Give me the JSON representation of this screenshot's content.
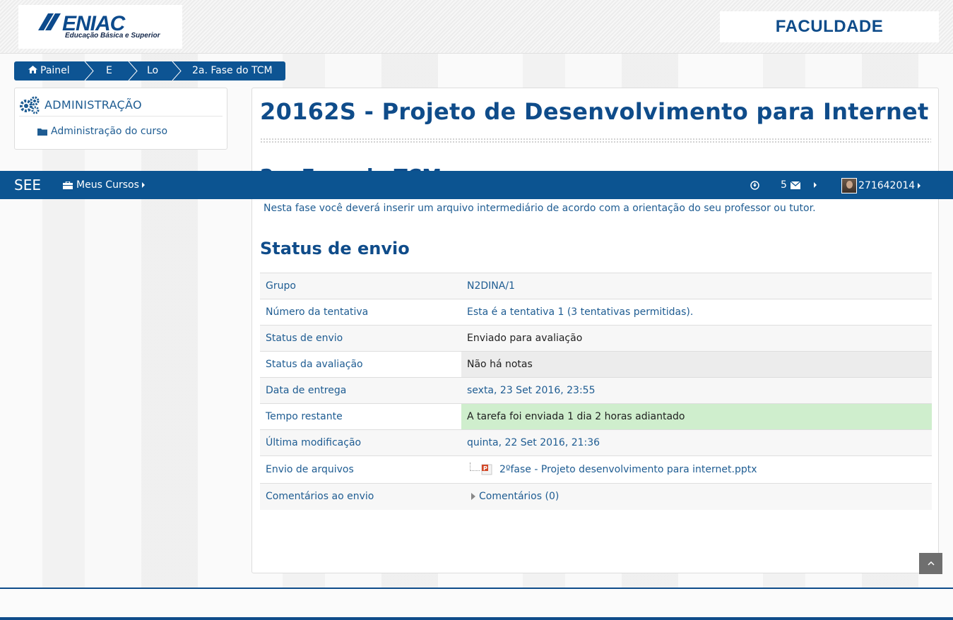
{
  "header": {
    "logo_text": "ENIAC",
    "logo_tagline": "Educação Básica e Superior",
    "faculdade_label": "FACULDADE"
  },
  "breadcrumb": [
    {
      "label": "Painel",
      "icon": "home-icon"
    },
    {
      "label": "E"
    },
    {
      "label": "Lo"
    },
    {
      "label": "2a. Fase do TCM"
    }
  ],
  "admin_block": {
    "title": "ADMINISTRAÇÃO",
    "link_label": "Administração do curso"
  },
  "navbar": {
    "brand": "SEE",
    "courses_label": "Meus Cursos",
    "messages_count": "5",
    "username": "271642014"
  },
  "main": {
    "course_title": "20162S - Projeto de Desenvolvimento para Internet",
    "phase_title": "2a. Fase do TCM",
    "phase_desc": "Nesta fase você deverá inserir um arquivo intermediário de acordo com a orientação do seu professor ou tutor.",
    "status_heading": "Status de envio",
    "rows": [
      {
        "label": "Grupo",
        "value": "N2DINA/1"
      },
      {
        "label": "Número da tentativa",
        "value": "Esta é a tentativa 1 (3 tentativas permitidas)."
      },
      {
        "label": "Status de envio",
        "value": "Enviado para avaliação"
      },
      {
        "label": "Status da avaliação",
        "value": "Não há notas"
      },
      {
        "label": "Data de entrega",
        "value": "sexta, 23 Set 2016, 23:55"
      },
      {
        "label": "Tempo restante",
        "value": "A tarefa foi enviada 1 dia 2 horas adiantado"
      },
      {
        "label": "Última modificação",
        "value": "quinta, 22 Set 2016, 21:36"
      },
      {
        "label": "Envio de arquivos",
        "value": "2ºfase - Projeto desenvolvimento para internet.pptx"
      },
      {
        "label": "Comentários ao envio",
        "value": "Comentários (0)"
      }
    ]
  },
  "colors": {
    "brand_blue": "#0c5491",
    "heading_blue": "#0f4c8a",
    "success_green": "#cfeecd"
  }
}
